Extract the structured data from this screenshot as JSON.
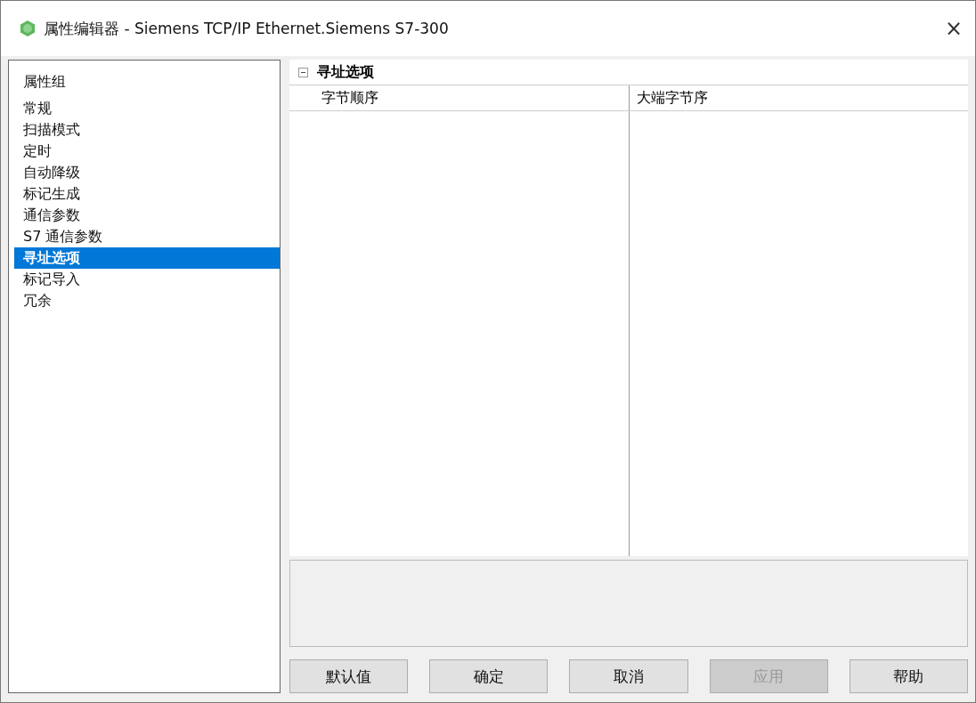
{
  "window": {
    "title": "属性编辑器 - Siemens TCP/IP Ethernet.Siemens S7-300",
    "close": "×"
  },
  "sidebar": {
    "items": [
      {
        "label": "属性组",
        "selected": false
      },
      {
        "label": "常规",
        "selected": false
      },
      {
        "label": "扫描模式",
        "selected": false
      },
      {
        "label": "定时",
        "selected": false
      },
      {
        "label": "自动降级",
        "selected": false
      },
      {
        "label": "标记生成",
        "selected": false
      },
      {
        "label": "通信参数",
        "selected": false
      },
      {
        "label": "S7 通信参数",
        "selected": false
      },
      {
        "label": "寻址选项",
        "selected": true
      },
      {
        "label": "标记导入",
        "selected": false
      },
      {
        "label": "冗余",
        "selected": false
      }
    ]
  },
  "group": {
    "title": "寻址选项",
    "expanded": true,
    "rows": [
      {
        "name": "字节顺序",
        "value": "大端字节序"
      }
    ]
  },
  "buttons": [
    {
      "label": "默认值",
      "disabled": false
    },
    {
      "label": "确定",
      "disabled": false
    },
    {
      "label": "取消",
      "disabled": false
    },
    {
      "label": "应用",
      "disabled": true
    },
    {
      "label": "帮助",
      "disabled": false
    }
  ]
}
